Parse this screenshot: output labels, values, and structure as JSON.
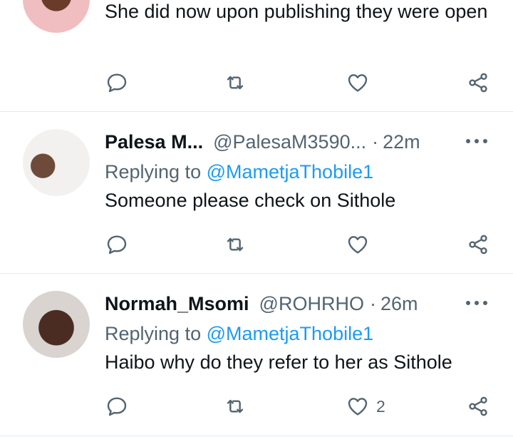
{
  "tweets": [
    {
      "body": "She did now upon publishing they were open"
    },
    {
      "name": "Palesa M...",
      "handle": "@PalesaM3590...",
      "separator": "·",
      "time": "22m",
      "replying_prefix": "Replying to",
      "replying_to": "@MametjaThobile1",
      "body": "Someone please check on Sithole"
    },
    {
      "name": "Normah_Msomi",
      "handle": "@ROHRHO",
      "separator": "·",
      "time": "26m",
      "replying_prefix": "Replying to",
      "replying_to": "@MametjaThobile1",
      "body": "Haibo why do they refer to her as Sithole",
      "like_count": "2"
    }
  ],
  "icons": {
    "reply": "reply-icon",
    "retweet": "retweet-icon",
    "like": "heart-icon",
    "share": "share-icon",
    "more": "more-icon"
  },
  "colors": {
    "mention": "#1d9bf0",
    "secondary_text": "#536471",
    "primary_text": "#0f1419",
    "divider": "#e6e9ec"
  }
}
